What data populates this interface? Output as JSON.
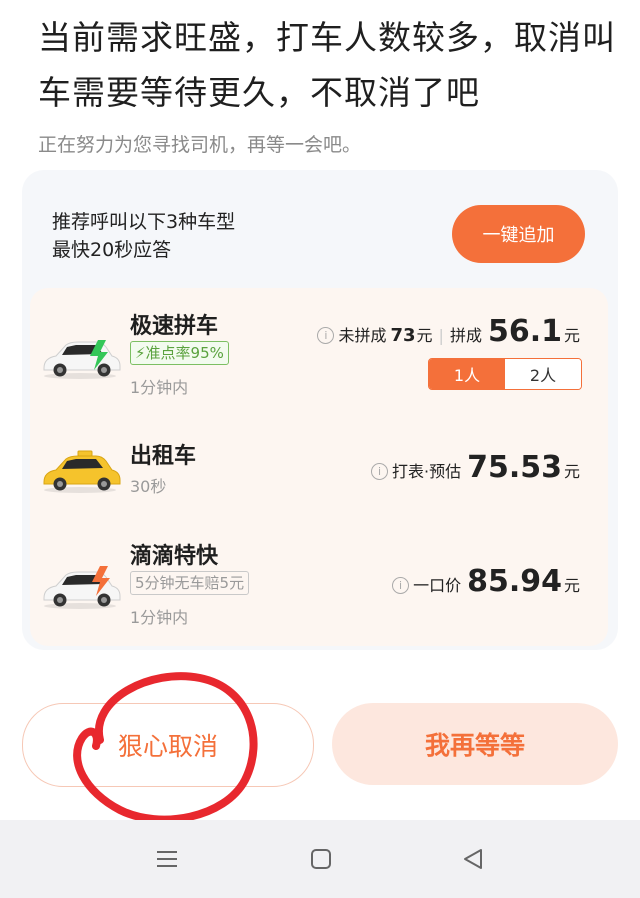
{
  "header": {
    "headline": "当前需求旺盛，打车人数较多，取消叫车需要等待更久，不取消了吧",
    "subline": "正在努力为您寻找司机，再等一会吧。"
  },
  "recommend": {
    "line1": "推荐呼叫以下3种车型",
    "line2": "最快20秒应答",
    "add_button": "一键追加"
  },
  "options": [
    {
      "name": "极速拼车",
      "tag": "准点率95%",
      "eta": "1分钟内",
      "unshared_label": "未拼成",
      "unshared_price": "73",
      "unit": "元",
      "shared_label": "拼成",
      "shared_price": "56.1",
      "seats": [
        "1人",
        "2人"
      ],
      "selected_seat": "1人"
    },
    {
      "name": "出租车",
      "eta": "30秒",
      "price_label": "打表·预估",
      "price": "75.53",
      "unit": "元"
    },
    {
      "name": "滴滴特快",
      "tag": "5分钟无车赔5元",
      "eta": "1分钟内",
      "price_label": "一口价",
      "price": "85.94",
      "unit": "元"
    }
  ],
  "actions": {
    "cancel": "狠心取消",
    "wait": "我再等等"
  },
  "colors": {
    "accent": "#f4703a",
    "green": "#5aa23e",
    "annotation_red": "#e8282e"
  }
}
